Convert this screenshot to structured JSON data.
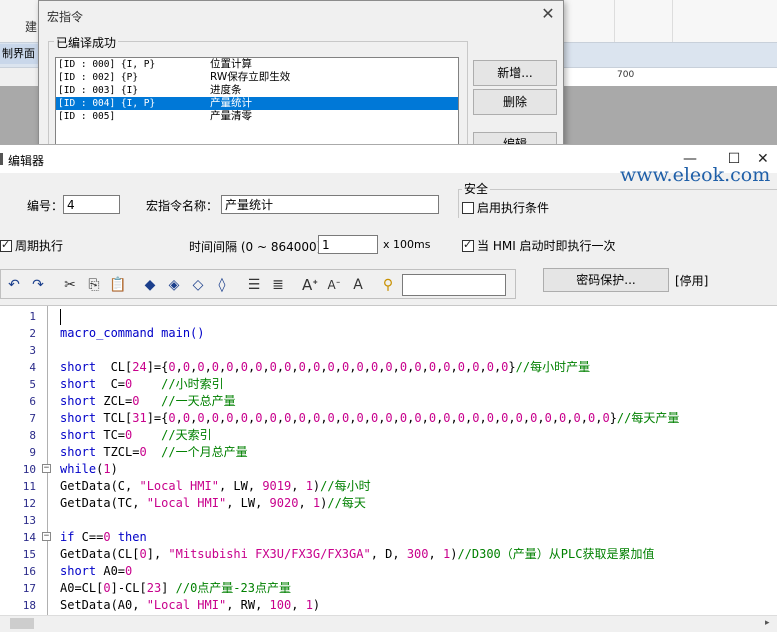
{
  "background": {
    "label": "建",
    "tab_label": "制界面",
    "ruler_number": "700"
  },
  "macro_dialog": {
    "title": "宏指令",
    "close_icon": "close-icon",
    "group_label": "已编译成功",
    "items": [
      {
        "id": "[ID : 000] {I, P}",
        "name": "位置计算"
      },
      {
        "id": "[ID : 002] {P}",
        "name": "RW保存立即生效"
      },
      {
        "id": "[ID : 003] {I}",
        "name": "进度条"
      },
      {
        "id": "[ID : 004] {I, P}",
        "name": "产量统计"
      },
      {
        "id": "[ID : 005]",
        "name": "产量清零"
      }
    ],
    "selected_index": 3,
    "buttons": {
      "new": "新增...",
      "delete": "删除",
      "edit": "编辑"
    }
  },
  "editor": {
    "title": "编辑器",
    "number_label": "编号：",
    "number_value": "4",
    "name_label": "宏指令名称：",
    "name_value": "产量统计",
    "security_label": "安全",
    "enable_condition_label": "启用执行条件",
    "periodic_label": "周期执行",
    "interval_label": "时间间隔 (0 ~ 864000)：",
    "interval_value": "1",
    "interval_unit": "x 100ms",
    "hmi_start_label": "当 HMI 启动时即执行一次",
    "password_button": "密码保护...",
    "disabled_label": "[停用]",
    "search_value": "",
    "toolbar_icons": [
      "undo-icon",
      "redo-icon",
      "cut-icon",
      "copy-icon",
      "paste-icon",
      "bookmark-icon",
      "bookmark-next-icon",
      "bookmark-prev-icon",
      "bookmark-clear-icon",
      "indent-icon",
      "outdent-icon",
      "font-larger-icon",
      "font-smaller-icon",
      "font-default-icon",
      "find-icon"
    ],
    "watermark": "www.eleok.com",
    "code_lines": [
      "",
      "macro_command main()",
      "",
      "short  CL[24]={0,0,0,0,0,0,0,0,0,0,0,0,0,0,0,0,0,0,0,0,0,0,0,0}//每小时产量",
      "short  C=0    //小时索引",
      "short ZCL=0   //一天总产量",
      "short TCL[31]={0,0,0,0,0,0,0,0,0,0,0,0,0,0,0,0,0,0,0,0,0,0,0,0,0,0,0,0,0,0,0}//每天产量",
      "short TC=0    //天索引",
      "short TZCL=0  //一个月总产量",
      "while(1)",
      "GetData(C, \"Local HMI\", LW, 9019, 1)//每小时",
      "GetData(TC, \"Local HMI\", LW, 9020, 1)//每天",
      "",
      "if C==0 then",
      "GetData(CL[0], \"Mitsubishi FX3U/FX3G/FX3GA\", D, 300, 1)//D300（产量）从PLC获取是累加值",
      "short A0=0",
      "A0=CL[0]-CL[23] //0点产量-23点产量",
      "SetData(A0, \"Local HMI\", RW, 100, 1)"
    ],
    "line_numbers": [
      "1",
      "2",
      "3",
      "4",
      "5",
      "6",
      "7",
      "8",
      "9",
      "10",
      "11",
      "12",
      "13",
      "14",
      "15",
      "16",
      "17",
      "18"
    ]
  }
}
